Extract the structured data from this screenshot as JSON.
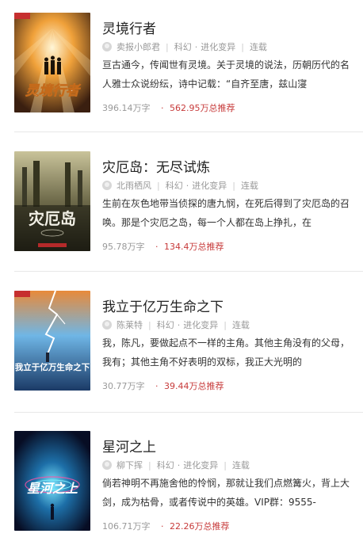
{
  "books": [
    {
      "title": "灵境行者",
      "author": "卖报小郎君",
      "genre": "科幻",
      "subgenre": "进化变异",
      "status": "连载",
      "description": "亘古通今，传闻世有灵境。关于灵境的说法，历朝历代的名人雅士众说纷纭，诗中记载：“自齐至唐，兹山寖",
      "words": "396.14万字",
      "recommend": "562.95万总推荐",
      "cover_text": "灵境行者"
    },
    {
      "title": "灾厄岛：无尽试炼",
      "author": "北雨栖风",
      "genre": "科幻",
      "subgenre": "进化变异",
      "status": "连载",
      "description": "生前在灰色地带当侦探的唐九悯，在死后得到了灾厄岛的召唤。那是个灾厄之岛，每一个人都在岛上挣扎，在",
      "words": "95.78万字",
      "recommend": "134.4万总推荐",
      "cover_text": "灾厄岛"
    },
    {
      "title": "我立于亿万生命之下",
      "author": "陈莱特",
      "genre": "科幻",
      "subgenre": "进化变异",
      "status": "连载",
      "description": "我，陈凡，要做起点不一样的主角。其他主角没有的父母，我有；其他主角不好表明的双标，我正大光明的",
      "words": "30.77万字",
      "recommend": "39.44万总推荐",
      "cover_text": "我立于亿万生命之下"
    },
    {
      "title": "星河之上",
      "author": "柳下挥",
      "genre": "科幻",
      "subgenre": "进化变异",
      "status": "连载",
      "description": "倘若神明不再施舍他的怜悯，那就让我们点燃篝火，背上大剑，成为枯骨，或者传说中的英雄。VIP群：9555-",
      "words": "106.71万字",
      "recommend": "22.26万总推荐",
      "cover_text": "星河之上"
    }
  ]
}
